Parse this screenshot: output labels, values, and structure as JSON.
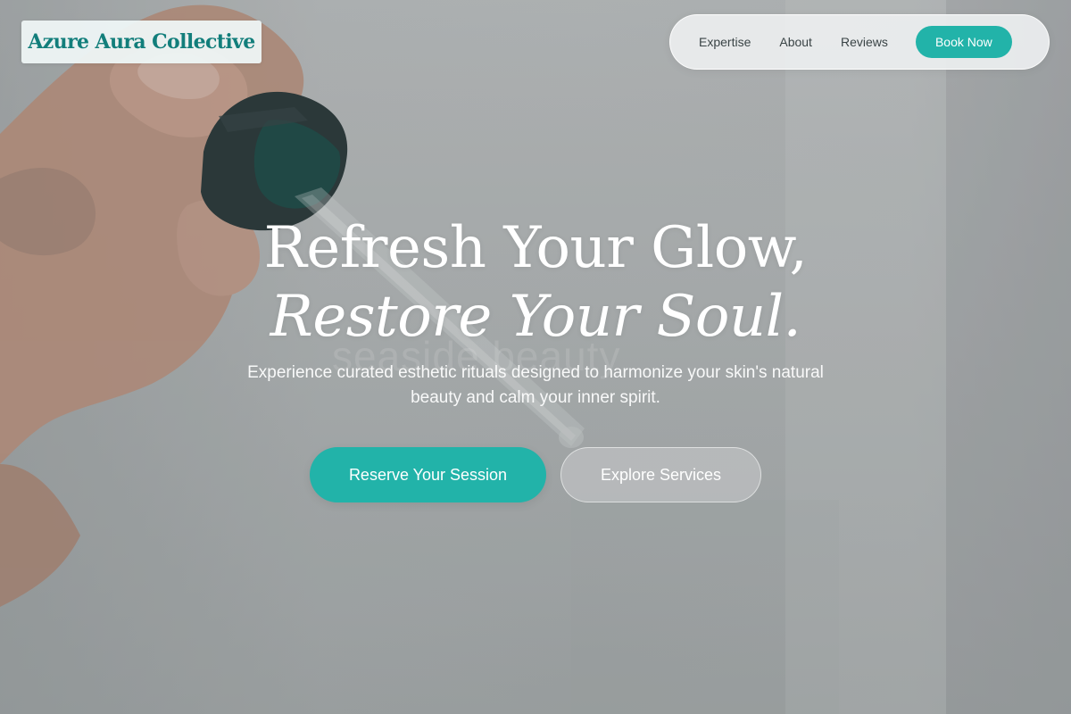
{
  "brand": {
    "name": "Azure Aura Collective"
  },
  "nav": {
    "links": [
      "Expertise",
      "About",
      "Reviews"
    ],
    "cta_label": "Book Now"
  },
  "hero": {
    "headline_line1": "Refresh Your Glow,",
    "headline_line2": "Restore Your Soul.",
    "subtitle": "Experience curated esthetic rituals designed to harmonize your skin's natural beauty and calm your inner spirit.",
    "primary_button": "Reserve Your Session",
    "secondary_button": "Explore Services",
    "background_watermark": "seaside beauty"
  },
  "colors": {
    "accent": "#22b3a9",
    "logo_text": "#127e7b",
    "nav_text": "#3a4446"
  }
}
